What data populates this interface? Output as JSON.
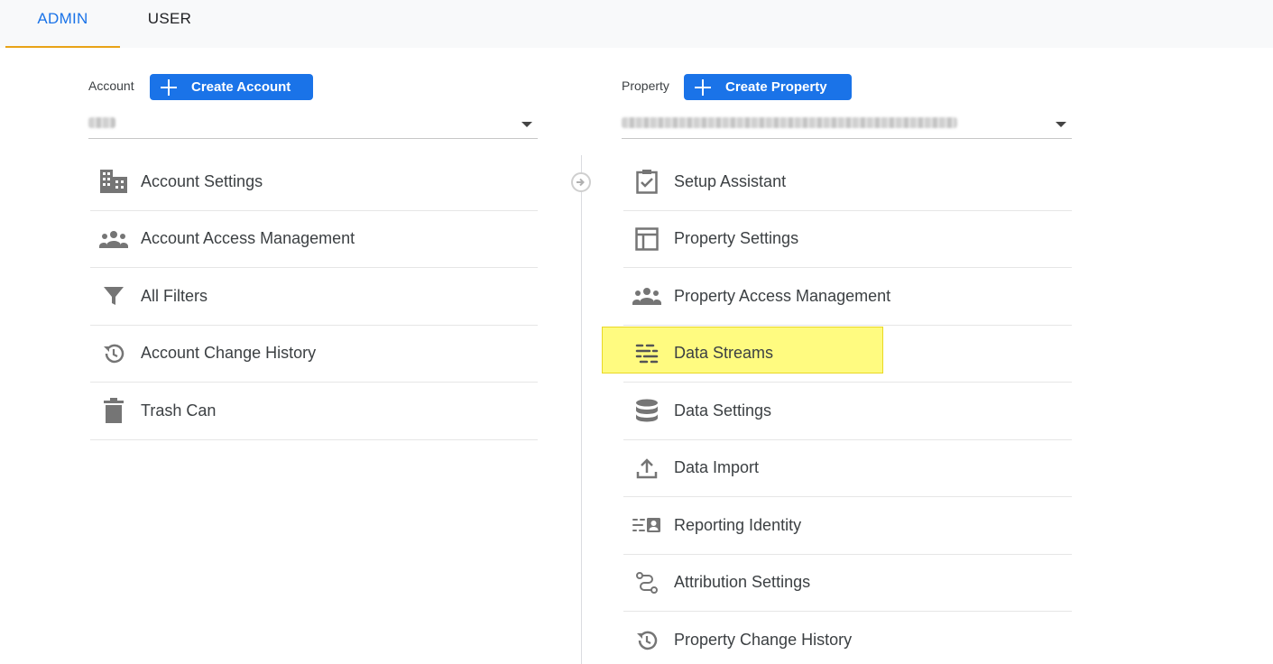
{
  "tabs": {
    "admin": "ADMIN",
    "user": "USER"
  },
  "account": {
    "label": "Account",
    "create_button": "Create Account",
    "items": [
      {
        "label": "Account Settings",
        "icon": "building-icon"
      },
      {
        "label": "Account Access Management",
        "icon": "people-icon"
      },
      {
        "label": "All Filters",
        "icon": "filter-icon"
      },
      {
        "label": "Account Change History",
        "icon": "history-icon"
      },
      {
        "label": "Trash Can",
        "icon": "trash-icon"
      }
    ]
  },
  "property": {
    "label": "Property",
    "create_button": "Create Property",
    "items": [
      {
        "label": "Setup Assistant",
        "icon": "clipboard-check-icon"
      },
      {
        "label": "Property Settings",
        "icon": "layout-icon"
      },
      {
        "label": "Property Access Management",
        "icon": "people-icon"
      },
      {
        "label": "Data Streams",
        "icon": "data-streams-icon",
        "highlighted": true
      },
      {
        "label": "Data Settings",
        "icon": "database-icon"
      },
      {
        "label": "Data Import",
        "icon": "upload-icon"
      },
      {
        "label": "Reporting Identity",
        "icon": "reporting-identity-icon"
      },
      {
        "label": "Attribution Settings",
        "icon": "route-icon"
      },
      {
        "label": "Property Change History",
        "icon": "history-icon"
      }
    ]
  },
  "colors": {
    "accent": "#1a73e8",
    "tab_underline": "#e8a317",
    "highlight": "#fffb6b",
    "icon": "#757575"
  }
}
